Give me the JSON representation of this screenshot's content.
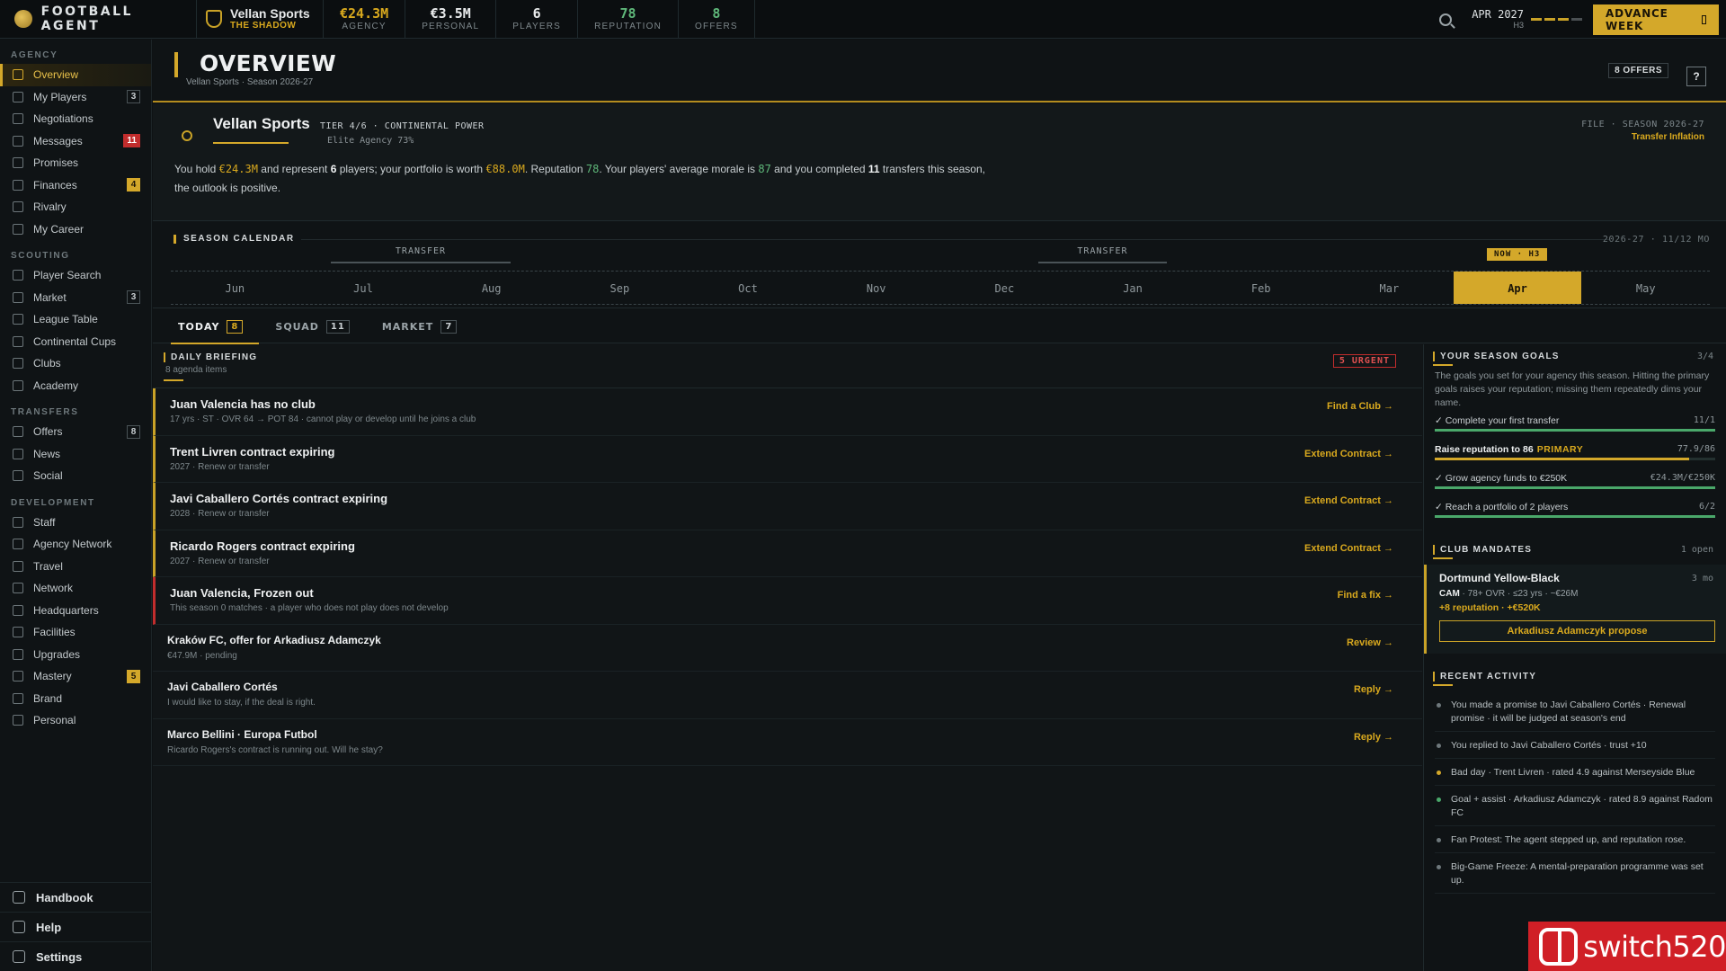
{
  "topbar": {
    "logo": "FOOTBALL AGENT",
    "agency_name": "Vellan Sports",
    "agency_alias": "THE SHADOW",
    "stats": [
      {
        "value": "€24.3M",
        "label": "AGENCY",
        "color": "#d9a91e"
      },
      {
        "value": "€3.5M",
        "label": "PERSONAL",
        "color": "#e8eaeb"
      },
      {
        "value": "6",
        "label": "PLAYERS",
        "color": "#e8eaeb"
      },
      {
        "value": "78",
        "label": "REPUTATION",
        "color": "#5fb87a"
      },
      {
        "value": "8",
        "label": "OFFERS",
        "color": "#5fb87a"
      }
    ],
    "date": "APR 2027",
    "half": "H3",
    "advance_label": "ADVANCE WEEK"
  },
  "sidebar": {
    "sections": [
      {
        "title": "AGENCY",
        "items": [
          {
            "label": "Overview",
            "active": true,
            "icon": "grid-icon"
          },
          {
            "label": "My Players",
            "badge": "3",
            "icon": "user-icon"
          },
          {
            "label": "Negotiations",
            "icon": "chat-icon"
          },
          {
            "label": "Messages",
            "badge": "11",
            "badge_style": "red",
            "icon": "mail-icon"
          },
          {
            "label": "Promises",
            "icon": "handshake-icon"
          },
          {
            "label": "Finances",
            "badge": "4",
            "badge_style": "gold",
            "icon": "coin-icon"
          },
          {
            "label": "Rivalry",
            "icon": "swords-icon"
          },
          {
            "label": "My Career",
            "icon": "person-icon"
          }
        ]
      },
      {
        "title": "SCOUTING",
        "items": [
          {
            "label": "Player Search",
            "icon": "search-icon"
          },
          {
            "label": "Market",
            "badge": "3",
            "icon": "bar-chart-icon"
          },
          {
            "label": "League Table",
            "icon": "table-icon"
          },
          {
            "label": "Continental Cups",
            "icon": "trophy-icon"
          },
          {
            "label": "Clubs",
            "icon": "shield-icon"
          },
          {
            "label": "Academy",
            "icon": "graduation-icon"
          }
        ]
      },
      {
        "title": "TRANSFERS",
        "items": [
          {
            "label": "Offers",
            "badge": "8",
            "icon": "arrows-icon"
          },
          {
            "label": "News",
            "icon": "globe-icon"
          },
          {
            "label": "Social",
            "icon": "broadcast-icon"
          }
        ]
      },
      {
        "title": "DEVELOPMENT",
        "items": [
          {
            "label": "Staff",
            "icon": "users-icon"
          },
          {
            "label": "Agency Network",
            "icon": "network-icon"
          },
          {
            "label": "Travel",
            "icon": "plane-icon"
          },
          {
            "label": "Network",
            "icon": "link-icon"
          },
          {
            "label": "Headquarters",
            "icon": "building-icon"
          },
          {
            "label": "Facilities",
            "icon": "dumbbell-icon"
          },
          {
            "label": "Upgrades",
            "icon": "trend-up-icon"
          },
          {
            "label": "Mastery",
            "badge": "5",
            "badge_style": "gold",
            "icon": "mastery-icon"
          },
          {
            "label": "Brand",
            "icon": "star-icon"
          },
          {
            "label": "Personal",
            "icon": "gem-icon"
          }
        ]
      }
    ],
    "bottom": [
      {
        "label": "Handbook",
        "icon": "book-icon"
      },
      {
        "label": "Help",
        "icon": "help-icon"
      },
      {
        "label": "Settings",
        "icon": "gear-icon"
      }
    ]
  },
  "header": {
    "title": "OVERVIEW",
    "subtitle": "Vellan Sports · Season 2026-27",
    "offers_tag": "8 OFFERS",
    "help": "?"
  },
  "agency_card": {
    "name": "Vellan Sports",
    "tier": "TIER 4/6 · CONTINENTAL POWER",
    "elite": "Elite Agency 73%",
    "file": "FILE · SEASON 2026-27",
    "inflation": "Transfer Inflation",
    "summary": {
      "p1": "You hold ",
      "funds": "€24.3M",
      "p2": " and represent ",
      "players": "6",
      "p3": " players; your portfolio is worth ",
      "worth": "€88.0M",
      "p4": ". Reputation ",
      "rep": "78",
      "p5": ". Your players' average morale is ",
      "morale": "87",
      "p6": " and you completed ",
      "transfers": "11",
      "p7": " transfers this season, the outlook is positive."
    }
  },
  "calendar": {
    "title": "SEASON CALENDAR",
    "range": "2026-27 · 11/12 MO",
    "months": [
      "Jun",
      "Jul",
      "Aug",
      "Sep",
      "Oct",
      "Nov",
      "Dec",
      "Jan",
      "Feb",
      "Mar",
      "Apr",
      "May"
    ],
    "current_month_index": 10,
    "now_tag": "NOW · H3",
    "windows": [
      {
        "label": "TRANSFER"
      },
      {
        "label": "TRANSFER"
      }
    ]
  },
  "tabs": [
    {
      "label": "TODAY",
      "count": "8",
      "active": true
    },
    {
      "label": "SQUAD",
      "count": "11"
    },
    {
      "label": "MARKET",
      "count": "7"
    }
  ],
  "briefing": {
    "title": "DAILY BRIEFING",
    "subtitle": "8 agenda items",
    "urgent": "5 URGENT",
    "items": [
      {
        "title": "Juan Valencia has no club",
        "sub": "17 yrs · ST · OVR 64 → POT 84 · cannot play or develop until he joins a club",
        "action": "Find a Club →",
        "flag": "gold"
      },
      {
        "title": "Trent Livren contract expiring",
        "sub": "2027 · Renew or transfer",
        "action": "Extend Contract →",
        "flag": "gold"
      },
      {
        "title": "Javi Caballero Cortés contract expiring",
        "sub": "2028 · Renew or transfer",
        "action": "Extend Contract →",
        "flag": "gold"
      },
      {
        "title": "Ricardo Rogers contract expiring",
        "sub": "2027 · Renew or transfer",
        "action": "Extend Contract →",
        "flag": "gold"
      },
      {
        "title": "Juan Valencia, Frozen out",
        "sub": "This season 0 matches · a player who does not play does not develop",
        "action": "Find a fix →",
        "flag": "red"
      },
      {
        "title": "Kraków FC, offer for Arkadiusz Adamczyk",
        "sub": "€47.9M · pending",
        "action": "Review →",
        "flag": "",
        "small": true
      },
      {
        "title": "Javi Caballero Cortés",
        "sub": "I would like to stay, if the deal is right.",
        "action": "Reply →",
        "flag": "",
        "small": true
      },
      {
        "title": "Marco Bellini · Europa Futbol",
        "sub": "Ricardo Rogers's contract is running out. Will he stay?",
        "action": "Reply →",
        "flag": "",
        "small": true
      }
    ]
  },
  "goals": {
    "title": "YOUR SEASON GOALS",
    "count": "3/4",
    "description": "The goals you set for your agency this season. Hitting the primary goals raises your reputation; missing them repeatedly dims your name.",
    "items": [
      {
        "label": "✓ Complete your first transfer",
        "value": "11/1",
        "progress": 1.0
      },
      {
        "label": "Raise reputation to 86",
        "tag": "PRIMARY",
        "value": "77.9/86",
        "progress": 0.906,
        "primary": true
      },
      {
        "label": "✓ Grow agency funds to €250K",
        "value": "€24.3M/€250K",
        "progress": 1.0
      },
      {
        "label": "✓ Reach a portfolio of 2 players",
        "value": "6/2",
        "progress": 1.0
      }
    ]
  },
  "mandates": {
    "title": "CLUB MANDATES",
    "count": "1 open",
    "club": "Dortmund Yellow-Black",
    "duration": "3 mo",
    "position": "CAM",
    "requirements": " · 78+ OVR · ≤23 yrs · ~€26M",
    "reward": "+8 reputation · +€520K",
    "button": "Arkadiusz Adamczyk propose"
  },
  "activity": {
    "title": "RECENT ACTIVITY",
    "items": [
      {
        "text": "You made a promise to Javi Caballero Cortés · Renewal promise · it will be judged at season's end",
        "dot": "grey"
      },
      {
        "text": "You replied to Javi Caballero Cortés · trust +10",
        "dot": "grey"
      },
      {
        "text": "Bad day · Trent Livren · rated 4.9 against Merseyside Blue",
        "dot": "gold"
      },
      {
        "text": "Goal + assist · Arkadiusz Adamczyk · rated 8.9 against Radom FC",
        "dot": "green"
      },
      {
        "text": "Fan Protest: The agent stepped up, and reputation rose.",
        "dot": "grey"
      },
      {
        "text": "Big-Game Freeze: A mental-preparation programme was set up.",
        "dot": "grey"
      }
    ]
  },
  "watermark": "switch520"
}
